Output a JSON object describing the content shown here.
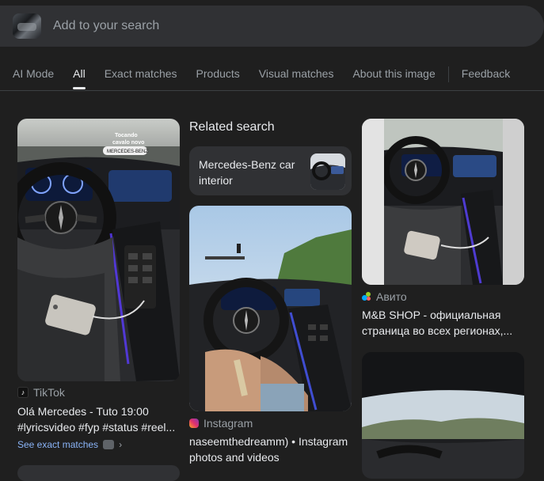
{
  "search": {
    "placeholder": "Add to your search"
  },
  "tabs": [
    {
      "label": "AI Mode"
    },
    {
      "label": "All"
    },
    {
      "label": "Exact matches"
    },
    {
      "label": "Products"
    },
    {
      "label": "Visual matches"
    },
    {
      "label": "About this image"
    },
    {
      "label": "Feedback"
    }
  ],
  "active_tab": "All",
  "cards": {
    "tiktok": {
      "source": "TikTok",
      "title_line1": "Olá Mercedes - Tuto 19:00",
      "title_line2": "#lyricsvideo #fyp #status #reel...",
      "exact_link": "See exact matches",
      "overlay_line1": "Tocando",
      "overlay_line2": "cavalo novo",
      "overlay_badge": "MERCEDES-BENZ"
    },
    "related": {
      "heading": "Related search",
      "text": "Mercedes-Benz car interior"
    },
    "instagram": {
      "source": "Instagram",
      "title_line1": "naseemthedreamm) • Instagram",
      "title_line2": "photos and videos"
    },
    "avito": {
      "source": "Авито",
      "title_line1": "M&B SHOP - официальная",
      "title_line2": "страница во всех регионах,..."
    }
  },
  "colors": {
    "background": "#1f1f1f",
    "searchbar": "#303134",
    "link": "#8ab4f8",
    "muted": "#9aa0a6"
  }
}
